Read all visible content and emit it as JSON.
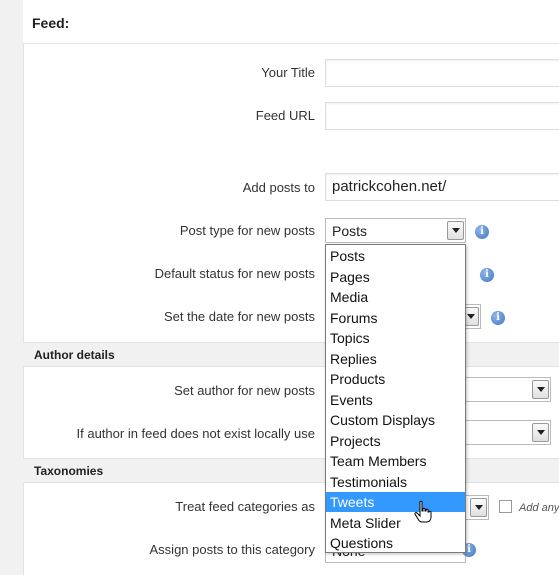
{
  "feed": {
    "title": "Feed:"
  },
  "fields": {
    "your_title": {
      "label": "Your Title",
      "value": ""
    },
    "feed_url": {
      "label": "Feed URL",
      "value": ""
    },
    "add_posts_to": {
      "label": "Add posts to",
      "value": "patrickcohen.net/"
    },
    "post_type": {
      "label": "Post type for new posts",
      "selected": "Posts"
    },
    "default_status": {
      "label": "Default status for new posts"
    },
    "set_date": {
      "label": "Set the date for new posts"
    }
  },
  "author_details": {
    "heading": "Author details",
    "set_author_label": "Set author for new posts",
    "missing_author_label": "If author in feed does not exist locally use"
  },
  "taxonomies": {
    "heading": "Taxonomies",
    "treat_categories_label": "Treat feed categories as",
    "add_any_label": "Add any",
    "assign_category_label": "Assign posts to this category",
    "assign_category_value": "None"
  },
  "post_type_dropdown": {
    "options": [
      "Posts",
      "Pages",
      "Media",
      "Forums",
      "Topics",
      "Replies",
      "Products",
      "Events",
      "Custom Displays",
      "Projects",
      "Team Members",
      "Testimonials",
      "Tweets",
      "Meta Slider",
      "Questions"
    ],
    "highlighted": "Tweets"
  },
  "icons": {
    "info": "info-icon",
    "arrow": "chevron-down-icon",
    "cursor": "hand-pointer-icon"
  },
  "colors": {
    "highlight": "#3399ff",
    "info": "#3f75c2"
  }
}
